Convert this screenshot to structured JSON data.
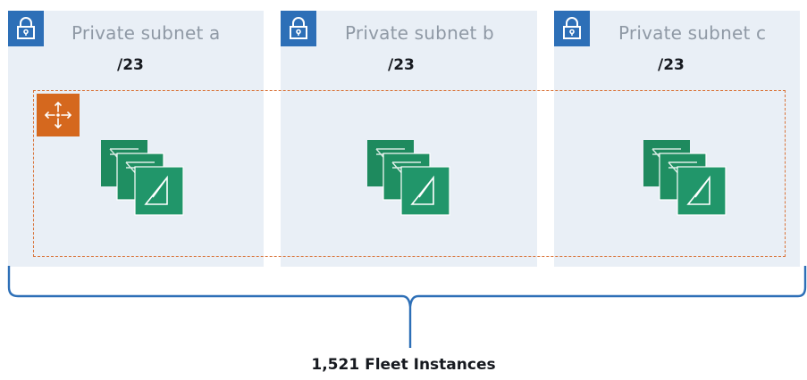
{
  "subnets": [
    {
      "name": "Private subnet a",
      "cidr": "/23",
      "icon": "lock-icon"
    },
    {
      "name": "Private subnet b",
      "cidr": "/23",
      "icon": "lock-icon"
    },
    {
      "name": "Private subnet c",
      "cidr": "/23",
      "icon": "lock-icon"
    }
  ],
  "group_icons": {
    "auto_scaling": "auto-scaling-icon",
    "instances": "ec2-instances-icon"
  },
  "colors": {
    "subnet_fill": "#e9eff6",
    "lock_badge": "#2d6fb7",
    "asg_border": "#d9743a",
    "asg_badge": "#d5681e",
    "instance_green": "#1e8a5e",
    "brace": "#2d6fb7"
  },
  "footer": {
    "label": "1,521 Fleet Instances"
  }
}
